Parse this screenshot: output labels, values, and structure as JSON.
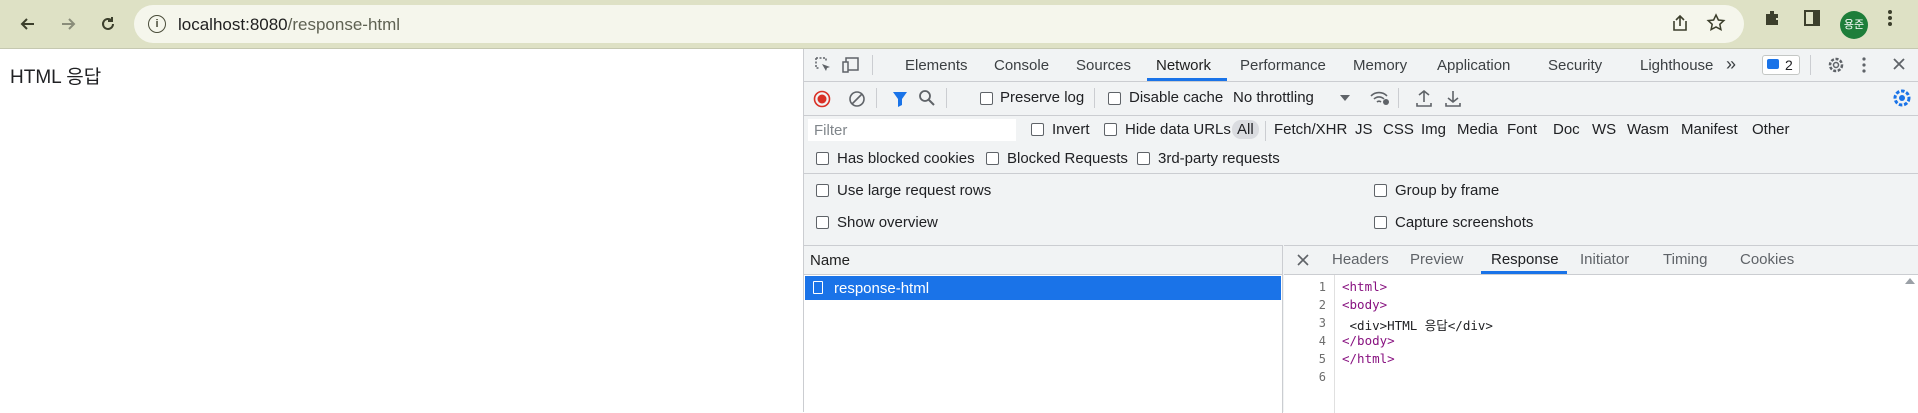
{
  "browser": {
    "url_host": "localhost:8080",
    "url_path": "/response-html",
    "avatar_text": "용준",
    "icons": [
      "back-arrow-icon",
      "forward-arrow-icon",
      "reload-icon",
      "site-info-icon",
      "share-icon",
      "star-icon",
      "extensions-icon",
      "side-panel-icon",
      "menu-kebab-icon"
    ]
  },
  "page": {
    "text": "HTML 응답"
  },
  "devtools": {
    "tabs": [
      "Elements",
      "Console",
      "Sources",
      "Network",
      "Performance",
      "Memory",
      "Application",
      "Security",
      "Lighthouse"
    ],
    "active_tab": "Network",
    "more_tabs": "»",
    "issues_count": "2",
    "toolbar": {
      "preserve_log": "Preserve log",
      "disable_cache": "Disable cache",
      "throttling": "No throttling"
    },
    "filter": {
      "placeholder": "Filter",
      "invert": "Invert",
      "hide_data_urls": "Hide data URLs",
      "types": [
        "All",
        "Fetch/XHR",
        "JS",
        "CSS",
        "Img",
        "Media",
        "Font",
        "Doc",
        "WS",
        "Wasm",
        "Manifest",
        "Other"
      ]
    },
    "options": {
      "has_blocked_cookies": "Has blocked cookies",
      "blocked_requests": "Blocked Requests",
      "third_party": "3rd-party requests",
      "large_rows": "Use large request rows",
      "group_by_frame": "Group by frame",
      "show_overview": "Show overview",
      "capture_screenshots": "Capture screenshots"
    },
    "name_header": "Name",
    "request_name": "response-html",
    "detail_tabs": [
      "Headers",
      "Preview",
      "Response",
      "Initiator",
      "Timing",
      "Cookies"
    ],
    "active_detail_tab": "Response",
    "response_lines": [
      {
        "n": "1",
        "t": "<html>"
      },
      {
        "n": "2",
        "t": "<body>"
      },
      {
        "n": "3",
        "t": " <div>HTML 응답</div>"
      },
      {
        "n": "4",
        "t": "</body>"
      },
      {
        "n": "5",
        "t": "</html>"
      },
      {
        "n": "6",
        "t": ""
      }
    ]
  }
}
